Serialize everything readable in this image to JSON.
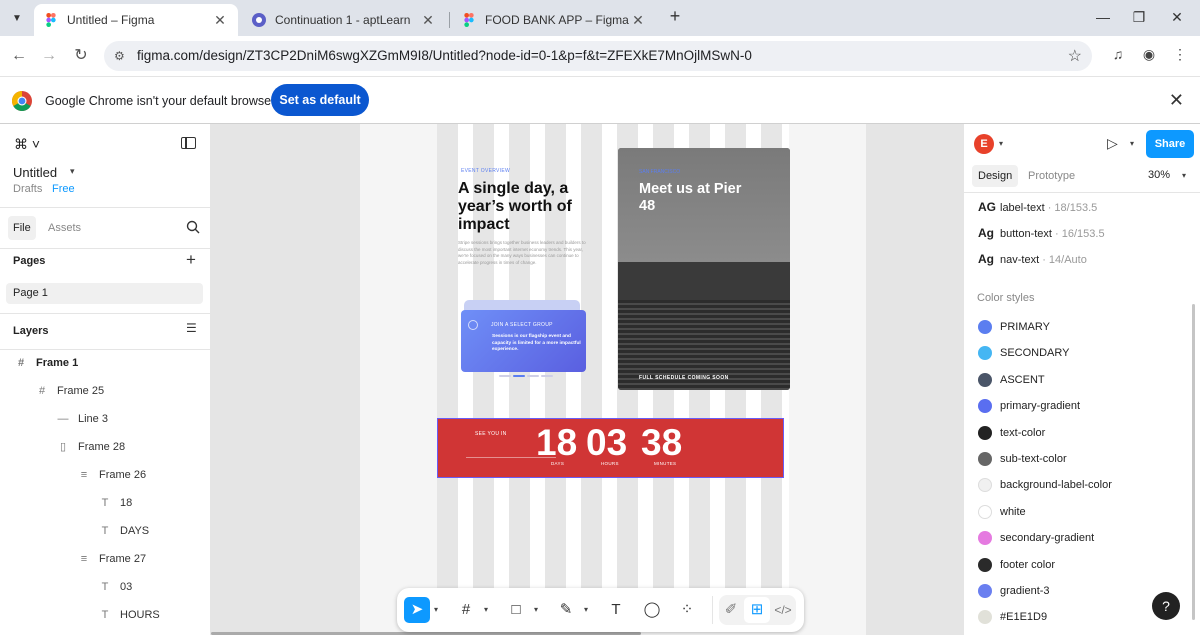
{
  "browser": {
    "tabs": [
      {
        "title": "Untitled – Figma",
        "close": "✕"
      },
      {
        "title": "Continuation 1 - aptLearn",
        "close": "✕"
      },
      {
        "title": "FOOD BANK APP – Figma",
        "close": "✕"
      }
    ],
    "new_tab": "+",
    "url": "figma.com/design/ZT3CP2DniM6swgXZGmM9I8/Untitled?node-id=0-1&p=f&t=ZFEXkE7MnOjlMSwN-0"
  },
  "infobar": {
    "message": "Google Chrome isn't your default browser",
    "button": "Set as default"
  },
  "left_panel": {
    "file_name": "Untitled",
    "location": "Drafts",
    "plan": "Free",
    "tabs": [
      "File",
      "Assets"
    ],
    "pages_title": "Pages",
    "pages": [
      "Page 1"
    ],
    "layers_title": "Layers",
    "layers": [
      {
        "name": "Frame 1",
        "icon": "#"
      },
      {
        "name": "Frame 25",
        "icon": "#"
      },
      {
        "name": "Line 3",
        "icon": "—"
      },
      {
        "name": "Frame 28",
        "icon": "▯"
      },
      {
        "name": "Frame 26",
        "icon": "≡"
      },
      {
        "name": "18",
        "icon": "T"
      },
      {
        "name": "DAYS",
        "icon": "T"
      },
      {
        "name": "Frame 27",
        "icon": "≡"
      },
      {
        "name": "03",
        "icon": "T"
      },
      {
        "name": "HOURS",
        "icon": "T"
      }
    ]
  },
  "canvas": {
    "hero": {
      "eyebrow": "EVENT OVERVIEW",
      "title": "A single day, a year’s worth of impact",
      "body": "Stripe sessions brings together business leaders and builders to discuss the most important internet economy trends. This year, we're focused on the many ways businesses can continue to accelerate progress in times of change."
    },
    "card": {
      "heading": "JOIN A SELECT GROUP",
      "body": "Sessions is our flagship event and capacity is limited for a more impactful experience."
    },
    "photo": {
      "eyebrow": "SAN FRANCISCO",
      "title": "Meet us at Pier 48",
      "footer": "FULL SCHEDULE COMING SOON"
    },
    "countdown": {
      "label": "SEE YOU IN",
      "days": "18",
      "days_label": "DAYS",
      "hours": "03",
      "hours_label": "HOURS",
      "minutes": "38",
      "minutes_label": "MINUTES"
    }
  },
  "right_panel": {
    "avatar_initial": "E",
    "share": "Share",
    "tabs": [
      "Design",
      "Prototype"
    ],
    "zoom": "30%",
    "text_styles": [
      {
        "glyph": "AG",
        "name": "label-text",
        "meta": "· 18/153.5"
      },
      {
        "glyph": "Ag",
        "name": "button-text",
        "meta": "· 16/153.5"
      },
      {
        "glyph": "Ag",
        "name": "nav-text",
        "meta": "· 14/Auto"
      }
    ],
    "color_styles_title": "Color styles",
    "color_styles": [
      {
        "name": "PRIMARY",
        "color": "#5b7ef0"
      },
      {
        "name": "SECONDARY",
        "color": "#45b6f3"
      },
      {
        "name": "ASCENT",
        "color": "#4a5568"
      },
      {
        "name": "primary-gradient",
        "color": "#5a6ef0"
      },
      {
        "name": "text-color",
        "color": "#222222"
      },
      {
        "name": "sub-text-color",
        "color": "#666666"
      },
      {
        "name": "background-label-color",
        "color": "#f0f0f0"
      },
      {
        "name": "white",
        "color": "#ffffff"
      },
      {
        "name": "secondary-gradient",
        "color": "#e57ae0"
      },
      {
        "name": "footer color",
        "color": "#2a2a2a"
      },
      {
        "name": "gradient-3",
        "color": "#6a7ff0"
      },
      {
        "name": "#E1E1D9",
        "color": "#e1e1d9"
      }
    ],
    "help": "?"
  }
}
